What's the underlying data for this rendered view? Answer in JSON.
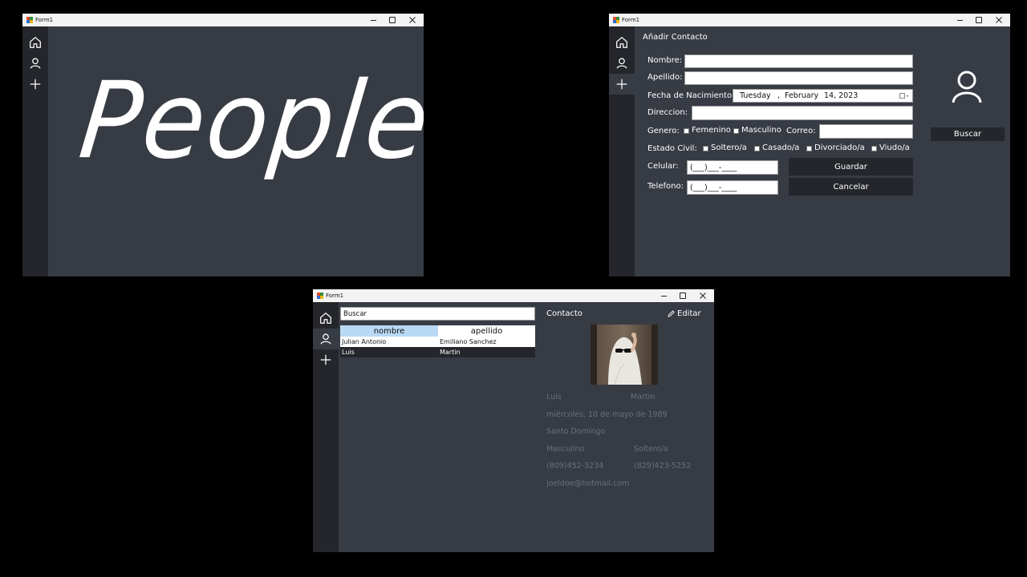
{
  "windows": {
    "home": {
      "title": "Form1",
      "splash_text": "People"
    },
    "add_contact": {
      "title": "Form1",
      "heading": "Añadir Contacto",
      "labels": {
        "nombre": "Nombre:",
        "apellido": "Apellido:",
        "fecha": "Fecha de Nacimiento:",
        "direccion": "Direccion:",
        "genero": "Genero:",
        "correo": "Correo:",
        "estado_civil": "Estado Civil:",
        "celular": "Celular:",
        "telefono": "Telefono:"
      },
      "date_picker": {
        "weekday": "Tuesday",
        "sep": ",",
        "month": "February",
        "day_year": "14, 2023"
      },
      "genero_options": [
        "Femenino",
        "Masculino"
      ],
      "estado_options": [
        "Soltero/a",
        "Casado/a",
        "Divorciado/a",
        "Viudo/a"
      ],
      "celular_mask": "(___)___-____",
      "telefono_mask": "(___)___-____",
      "buttons": {
        "guardar": "Guardar",
        "cancelar": "Cancelar",
        "buscar": "Buscar"
      }
    },
    "contacts": {
      "title": "Form1",
      "search_value": "Buscar",
      "columns": [
        "nombre",
        "apellido"
      ],
      "rows": [
        [
          "Julian Antonio",
          "Emiliano Sanchez"
        ],
        [
          "Luis",
          "Martin"
        ]
      ],
      "selected_row": 1,
      "detail": {
        "header": "Contacto",
        "edit_label": "Editar",
        "first_name": "Luis",
        "last_name": "Martin",
        "birth": "miércoles, 10 de mayo de 1989",
        "address": "Santo Domingo",
        "gender": "Masculino",
        "civil_status": "Soltero/a",
        "cellphone": "(809)452-3234",
        "phone": "(829)423-5252",
        "email": "joeldoe@hotmail.com"
      }
    }
  },
  "colors": {
    "window_bg": "#373b44",
    "sidebar_bg": "#24262b",
    "grid_header": "#b9d9f5",
    "muted_text": "#6b6f78"
  }
}
